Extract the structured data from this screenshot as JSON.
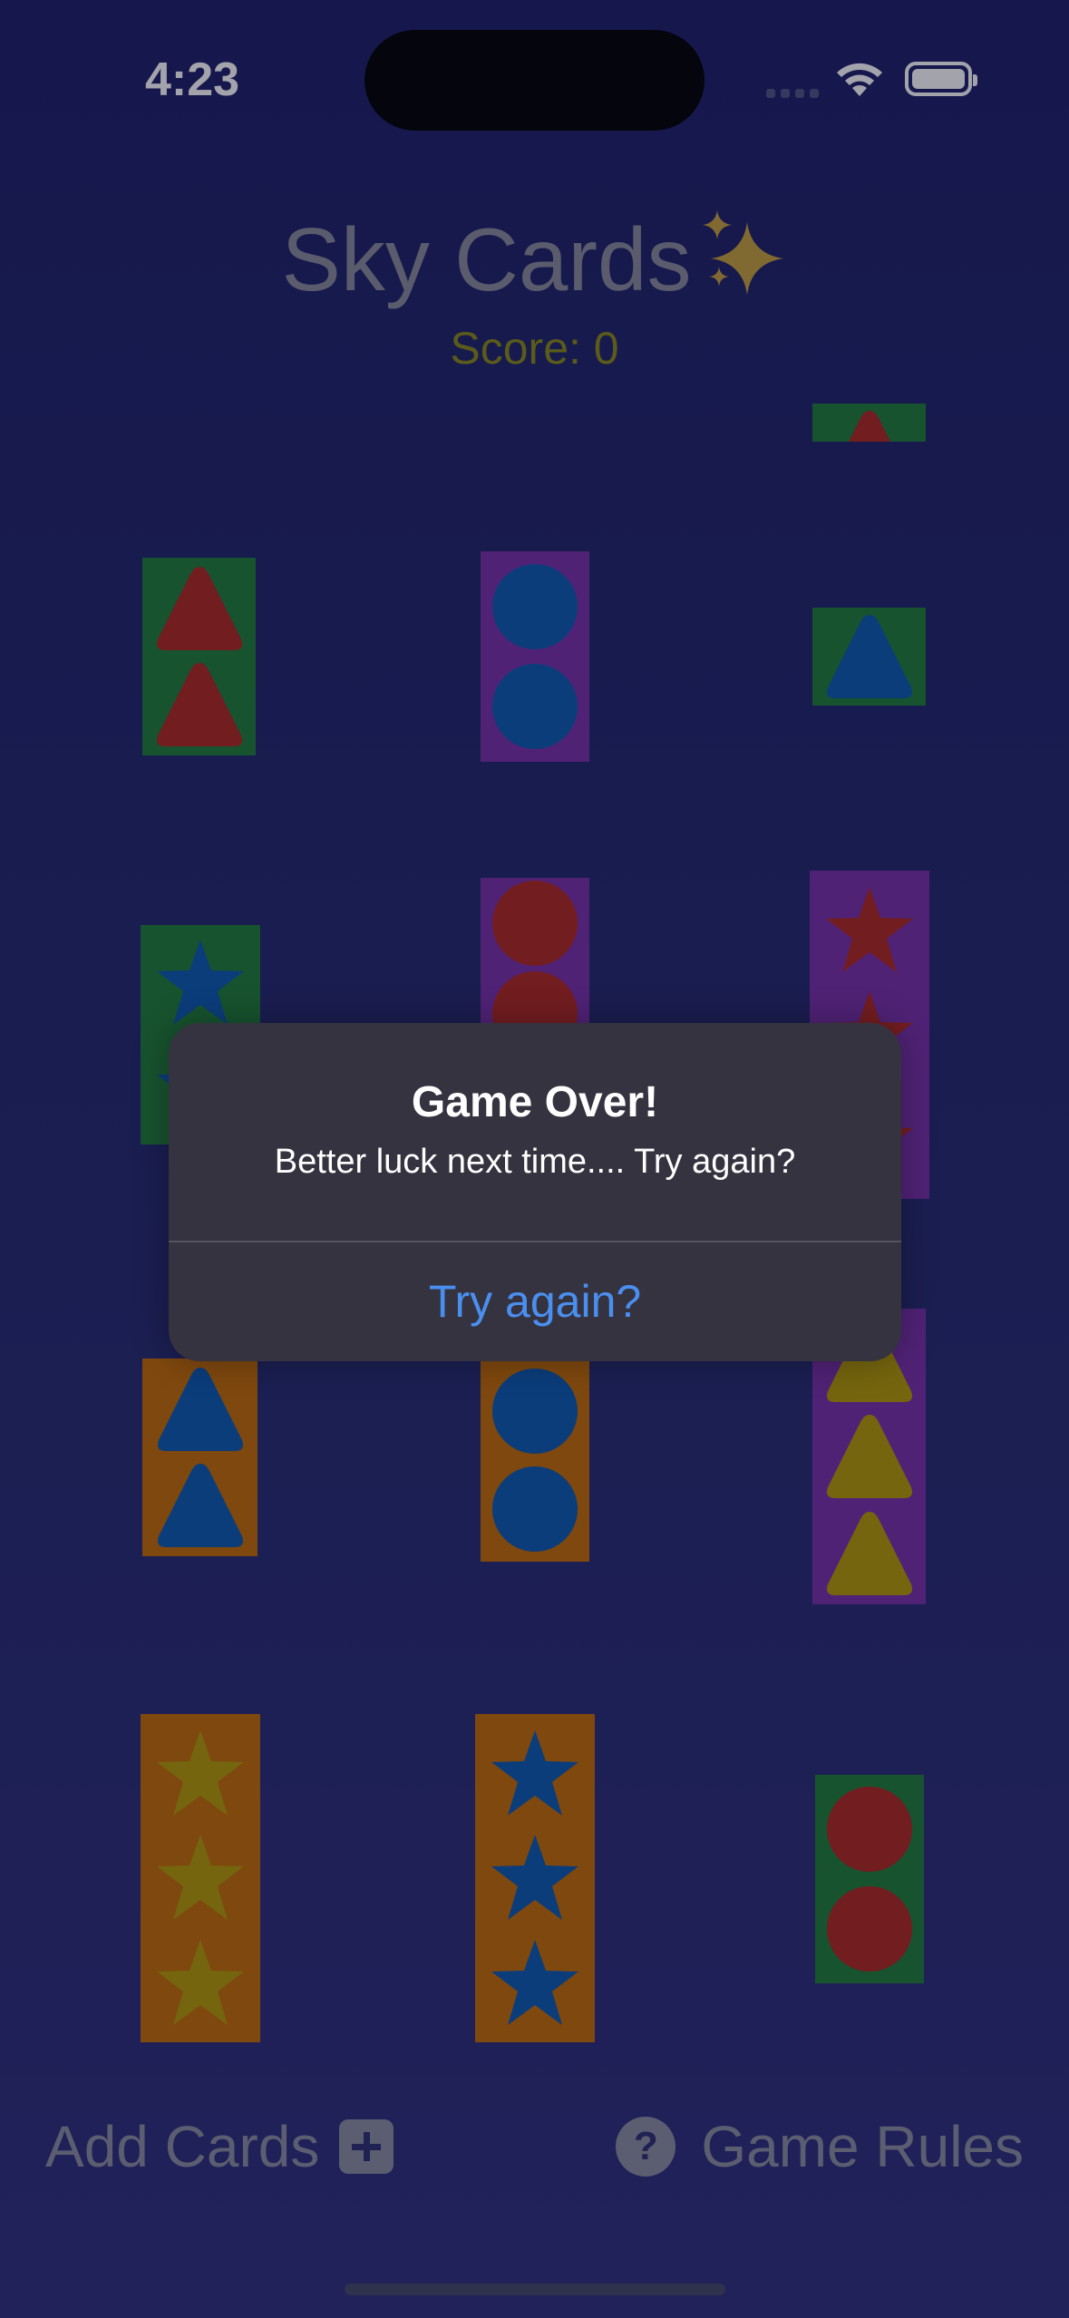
{
  "status_bar": {
    "time": "4:23"
  },
  "header": {
    "title": "Sky Cards",
    "score": "Score: 0"
  },
  "cards": [
    {
      "bg": "#1e7e34",
      "shape": "triangle",
      "fill": "#b0281d",
      "count": 1,
      "partial": true
    },
    {
      "bg": "#1e7e34",
      "shape": "triangle",
      "fill": "#b0281d",
      "count": 2
    },
    {
      "bg": "#7a2fa8",
      "shape": "circle",
      "fill": "#0a5bb0",
      "count": 2
    },
    {
      "bg": "#1e7e34",
      "shape": "triangle",
      "fill": "#0a5bb0",
      "count": 1
    },
    {
      "bg": "#1e7e34",
      "shape": "star",
      "fill": "#0a5bb0",
      "count": 2
    },
    {
      "bg": "#7a2fa8",
      "shape": "circle",
      "fill": "#b0281d",
      "count": 2
    },
    {
      "bg": "#7a2fa8",
      "shape": "star",
      "fill": "#b0281d",
      "count": 3
    },
    {
      "bg": "#c56c00",
      "shape": "triangle",
      "fill": "#0a5bb0",
      "count": 2
    },
    {
      "bg": "#c56c00",
      "shape": "circle",
      "fill": "#0a5bb0",
      "count": 2
    },
    {
      "bg": "#7a2fa8",
      "shape": "triangle",
      "fill": "#b59b00",
      "count": 3
    },
    {
      "bg": "#c56c00",
      "shape": "star",
      "fill": "#b59b00",
      "count": 3
    },
    {
      "bg": "#c56c00",
      "shape": "star",
      "fill": "#0a5bb0",
      "count": 3
    },
    {
      "bg": "#1e7e34",
      "shape": "circle",
      "fill": "#b0281d",
      "count": 2
    }
  ],
  "toolbar": {
    "add_label": "Add Cards",
    "rules_label": "Game Rules"
  },
  "alert": {
    "title": "Game Over!",
    "message": "Better luck next time.... Try again?",
    "button": "Try again?"
  }
}
